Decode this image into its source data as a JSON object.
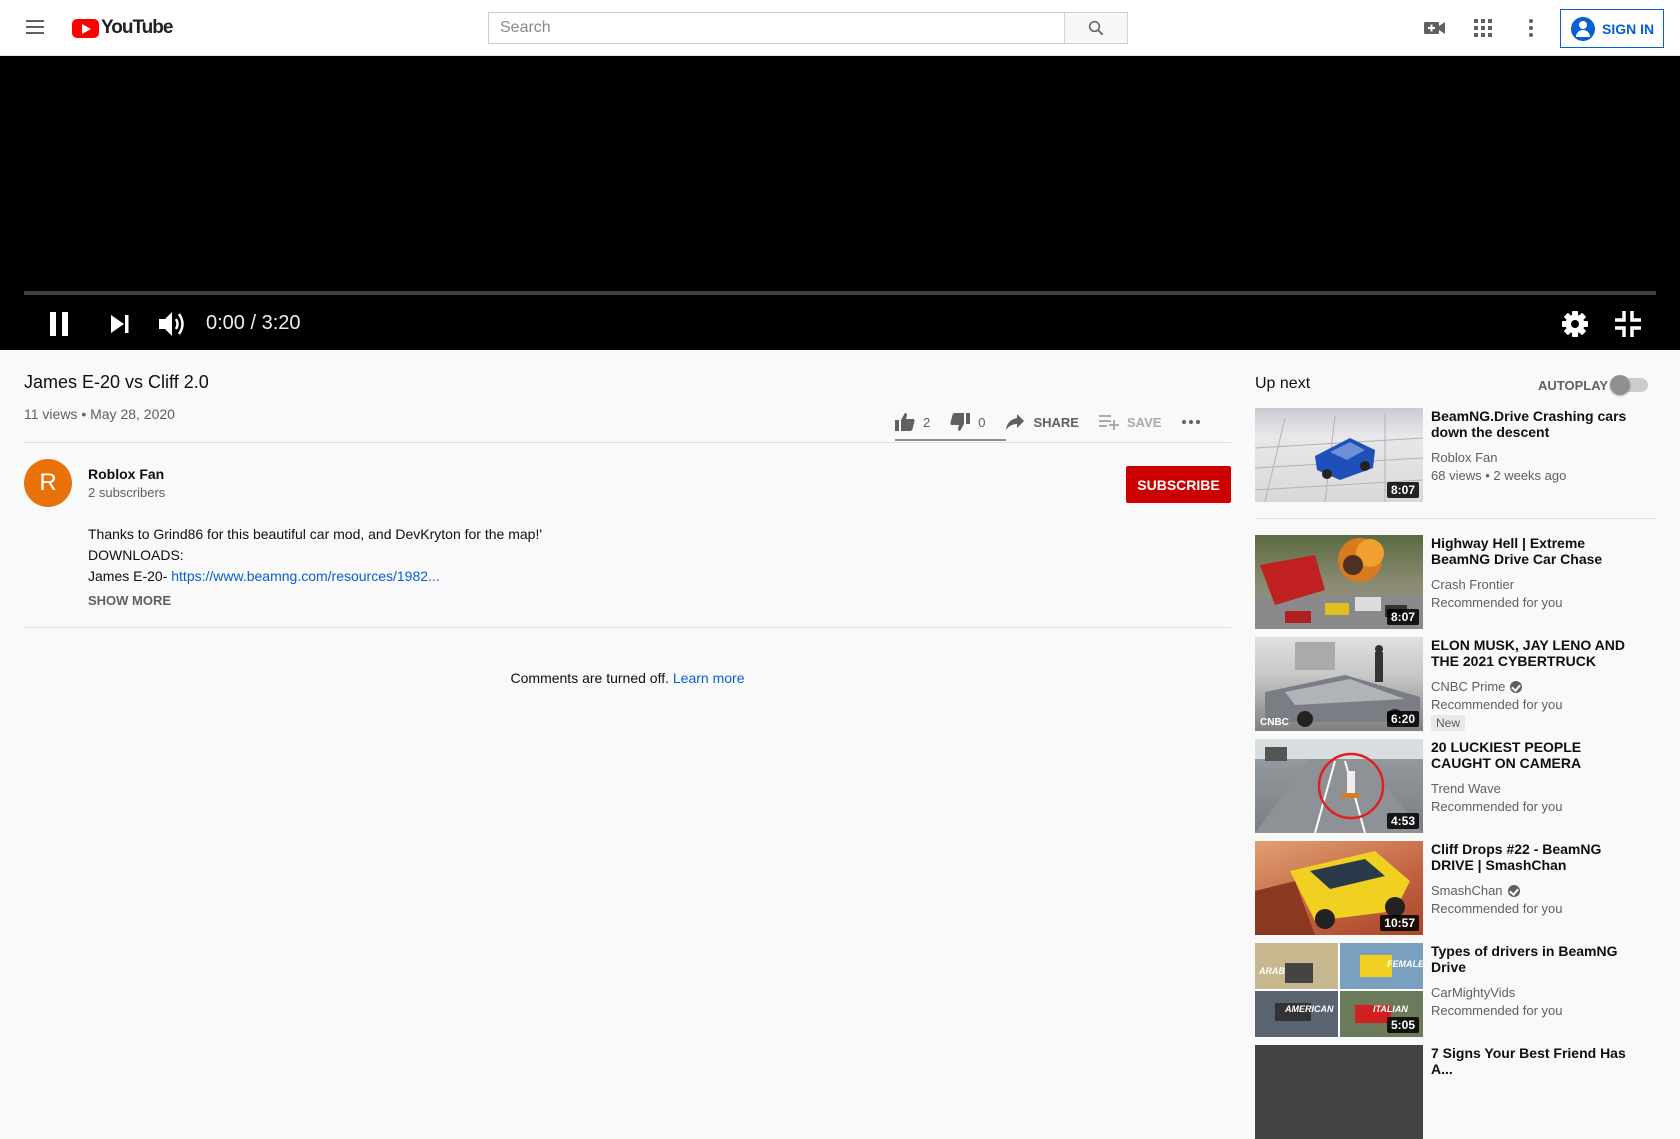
{
  "header": {
    "logo_text": "YouTube",
    "search_placeholder": "Search",
    "signin_label": "SIGN IN"
  },
  "player": {
    "time": "0:00 / 3:20",
    "progress": 0
  },
  "video": {
    "title": "James E-20 vs Cliff 2.0",
    "meta": "11 views • May 28, 2020",
    "likes": "2",
    "dislikes": "0",
    "share_label": "SHARE",
    "save_label": "SAVE"
  },
  "channel": {
    "avatar_letter": "R",
    "name": "Roblox Fan",
    "subscribers": "2 subscribers",
    "subscribe_label": "SUBSCRIBE"
  },
  "description": {
    "line1": "Thanks to Grind86 for this beautiful car mod, and DevKryton for the map!'",
    "line2": "DOWNLOADS:",
    "line3_prefix": "James E-20- ",
    "line3_link": "https://www.beamng.com/resources/1982...",
    "show_more": "SHOW MORE"
  },
  "comments": {
    "text": "Comments are turned off.",
    "link": "Learn more"
  },
  "sidebar": {
    "up_next": "Up next",
    "autoplay": "AUTOPLAY",
    "videos": [
      {
        "title": "BeamNG.Drive Crashing cars down the descent",
        "channel": "Roblox Fan",
        "sub": "68 views • 2 weeks ago",
        "duration": "8:07"
      },
      {
        "title": "Highway Hell | Extreme BeamNG Drive Car Chase",
        "channel": "Crash Frontier",
        "sub": "Recommended for you",
        "duration": "8:07"
      },
      {
        "title": "ELON MUSK, JAY LENO AND THE 2021 CYBERTRUCK (FUL...",
        "channel": "CNBC Prime",
        "sub": "Recommended for you",
        "duration": "6:20",
        "badge": "New",
        "thumb_label": "CNBC"
      },
      {
        "title": "20 LUCKIEST PEOPLE CAUGHT ON CAMERA",
        "channel": "Trend Wave",
        "sub": "Recommended for you",
        "duration": "4:53"
      },
      {
        "title": "Cliff Drops #22 - BeamNG DRIVE | SmashChan",
        "channel": "SmashChan",
        "sub": "Recommended for you",
        "duration": "10:57"
      },
      {
        "title": "Types of drivers in BeamNG Drive",
        "channel": "CarMightyVids",
        "sub": "Recommended for you",
        "duration": "5:05",
        "thumb_labels": [
          "ARAB",
          "FEMALE",
          "AMERICAN",
          "ITALIAN"
        ]
      },
      {
        "title": "7 Signs Your Best Friend Has A..."
      }
    ]
  },
  "colors": {
    "brand_red": "#ff0000",
    "subscribe_red": "#cc0000",
    "link_blue": "#065fd4"
  }
}
